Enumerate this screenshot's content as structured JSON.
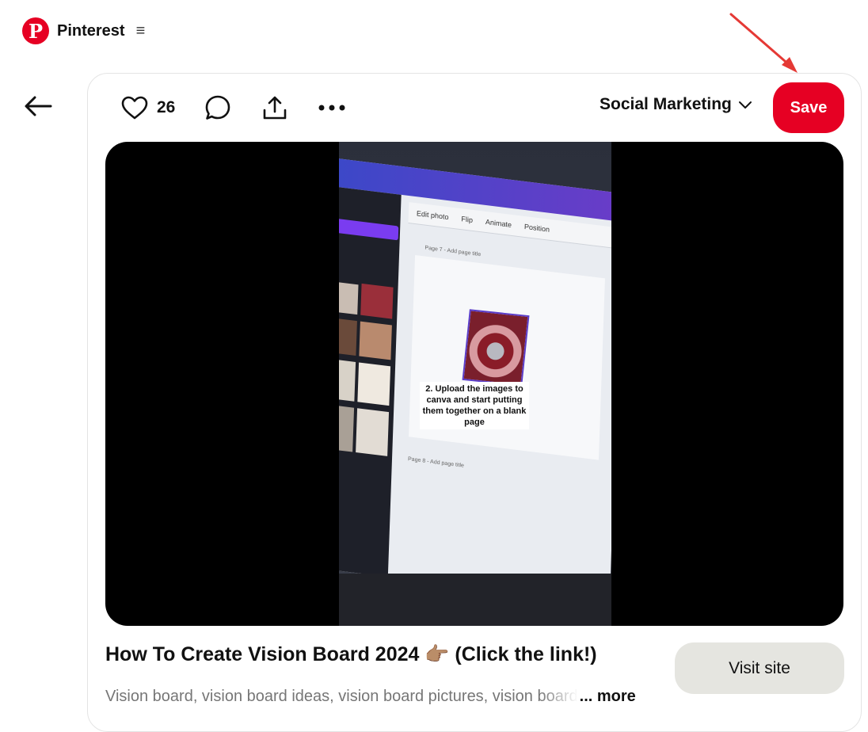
{
  "header": {
    "brand": "Pinterest",
    "logo_letter": "P",
    "menu_icon": "≡"
  },
  "pin": {
    "like_count": "26",
    "board": "Social Marketing",
    "save_label": "Save",
    "title": "How To Create Vision Board 2024 👉🏽 (Click the link!)",
    "description": "Vision board, vision board ideas, vision board pictures, vision board",
    "more_label": "... more",
    "visit_label": "Visit site"
  },
  "video": {
    "caption": "2. Upload the images to canva and start putting them together on a blank page",
    "toolbar_items": [
      "Edit photo",
      "Flip",
      "Animate",
      "Position"
    ],
    "page7_label": "Page 7 - Add page title",
    "page8_label": "Page 8 - Add page title"
  },
  "colors": {
    "brand": "#e60023",
    "visit_bg": "#e5e5e0",
    "annotation_arrow": "#e53935"
  },
  "icons": [
    "pinterest-logo",
    "menu-icon",
    "back-arrow-icon",
    "heart-icon",
    "comment-icon",
    "share-icon",
    "more-icon",
    "chevron-down-icon"
  ]
}
